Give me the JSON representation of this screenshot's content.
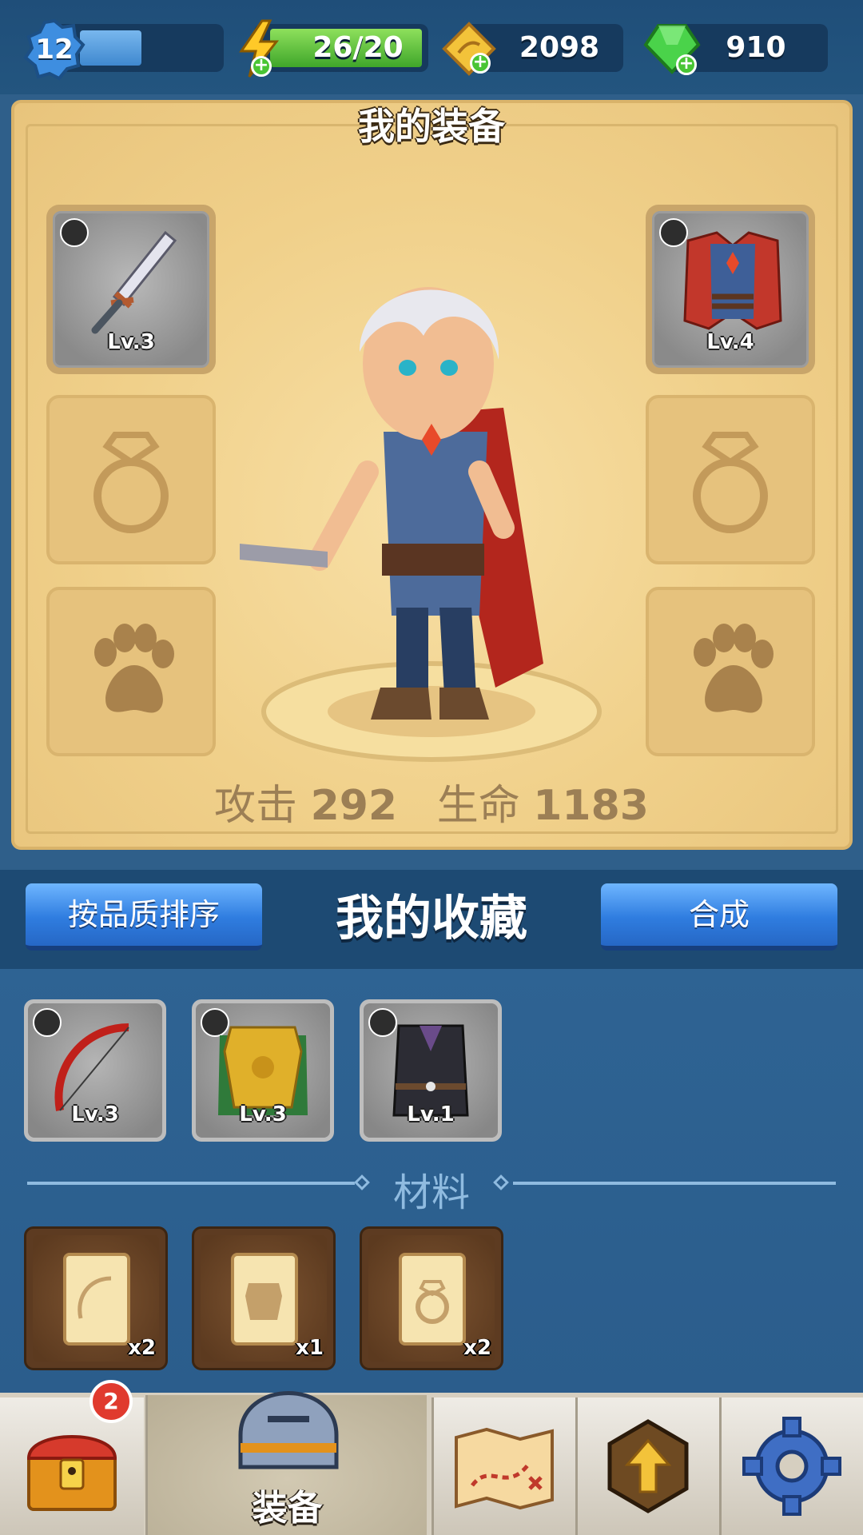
{
  "topbar": {
    "level": "12",
    "level_progress": 0.45,
    "energy": "26/20",
    "gold": "2098",
    "gems": "910"
  },
  "equipment": {
    "title": "我的装备",
    "weapon": {
      "level": "Lv.3",
      "icon": "serrated-sword-icon"
    },
    "armor": {
      "level": "Lv.4",
      "icon": "red-cape-armor-icon"
    },
    "empty_slots": [
      "ring-slot-icon",
      "ring-slot-icon",
      "paw-pet-slot-icon",
      "paw-pet-slot-icon"
    ],
    "stats": {
      "attack_label": "攻击",
      "attack_value": "292",
      "hp_label": "生命",
      "hp_value": "1183"
    }
  },
  "collection": {
    "sort_button": "按品质排序",
    "title": "我的收藏",
    "merge_button": "合成",
    "items": [
      {
        "level": "Lv.3",
        "icon": "red-bow-icon",
        "category": "weapon"
      },
      {
        "level": "Lv.3",
        "icon": "golden-armor-icon",
        "category": "armor"
      },
      {
        "level": "Lv.1",
        "icon": "dark-vest-icon",
        "category": "armor"
      }
    ]
  },
  "materials": {
    "title": "材料",
    "items": [
      {
        "count": "x2",
        "icon": "bow-scroll-icon"
      },
      {
        "count": "x1",
        "icon": "armor-scroll-icon"
      },
      {
        "count": "x2",
        "icon": "ring-scroll-icon"
      }
    ]
  },
  "nav": {
    "chest_badge": "2",
    "active_label": "装备",
    "tabs": [
      "chest-icon",
      "helmet-icon",
      "map-icon",
      "upgrade-arrow-icon",
      "settings-gear-icon"
    ]
  },
  "colors": {
    "panel": "#f0d08a",
    "blue_button": "#2f7de0",
    "background": "#2f5f8a"
  }
}
